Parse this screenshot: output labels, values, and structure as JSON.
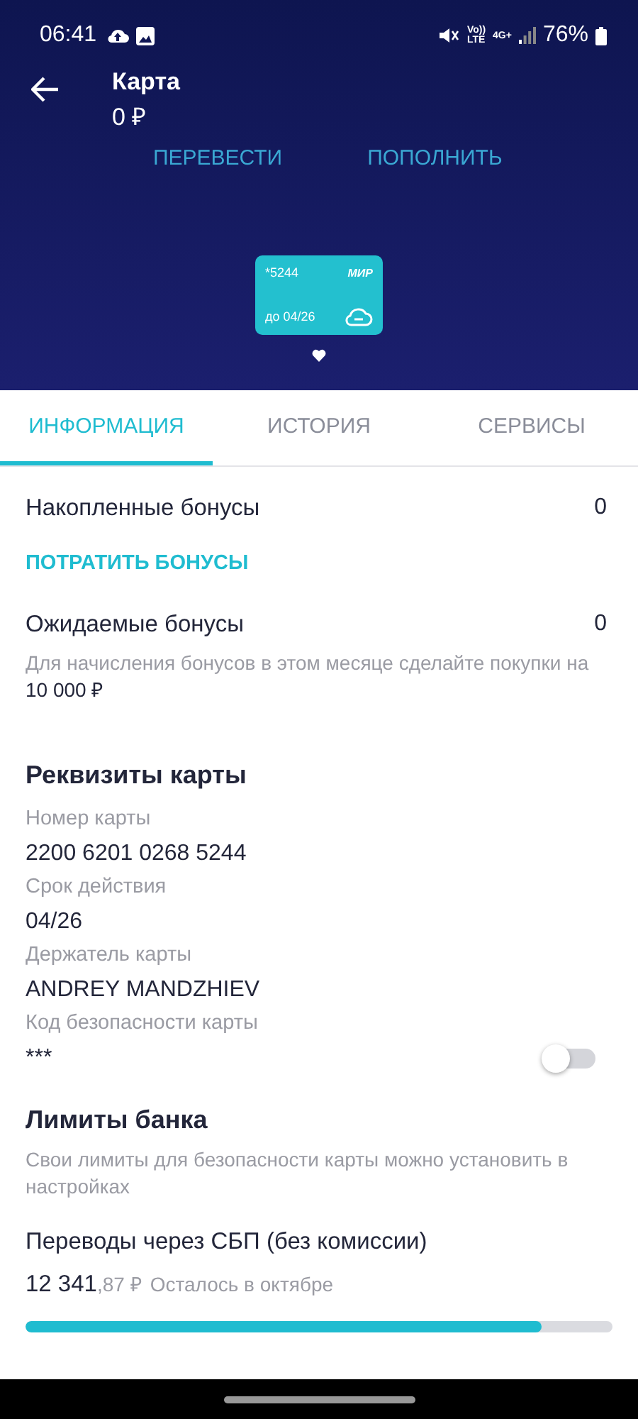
{
  "status_bar": {
    "time": "06:41",
    "volte": "Vo))\nLTE",
    "network": "4G+",
    "battery": "76%"
  },
  "header": {
    "title": "Карта",
    "balance": "0 ₽",
    "actions": [
      "ПЕРЕВЕСТИ",
      "ПОПОЛНИТЬ"
    ]
  },
  "card": {
    "number": "*5244",
    "brand": "МИР",
    "expiry": "до 04/26"
  },
  "tabs": [
    {
      "label": "ИНФОРМАЦИЯ",
      "selected": true
    },
    {
      "label": "ИСТОРИЯ",
      "selected": false
    },
    {
      "label": "СЕРВИСЫ",
      "selected": false
    }
  ],
  "bonuses": {
    "accumulated_label": "Накопленные бонусы",
    "accumulated_value": "0",
    "spend_link": "ПОТРАТИТЬ БОНУСЫ",
    "expected_label": "Ожидаемые бонусы",
    "expected_value": "0",
    "hint": "Для начисления бонусов в этом месяце сделайте покупки на **10 000 ₽**"
  },
  "details": {
    "title": "Реквизиты карты",
    "fields": [
      {
        "label": "Номер карты",
        "value": "2200 6201 0268 5244"
      },
      {
        "label": "Срок действия",
        "value": "04/26"
      },
      {
        "label": "Держатель карты",
        "value": "ANDREY MANDZHIEV"
      },
      {
        "label": "Код безопасности карты",
        "value": "***",
        "toggle": {
          "on": false
        }
      }
    ]
  },
  "limits": {
    "title": "Лимиты банка",
    "hint": "Свои лимиты для безопасности карты можно установить в настройках",
    "items": [
      {
        "label": "Переводы через СБП (без комиссии)",
        "amount": "**12 341**,87 ₽",
        "note": "Осталось в октябре",
        "level": 0.88
      }
    ]
  }
}
